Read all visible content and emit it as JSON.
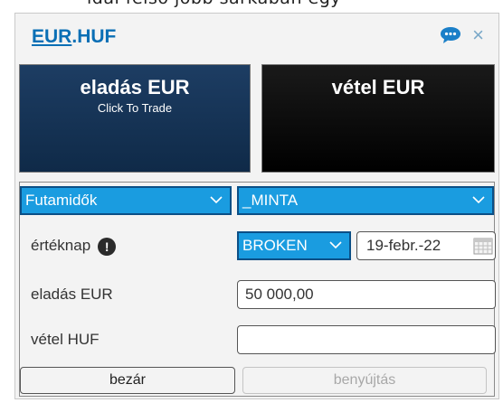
{
  "top_caption": "ldal felsó jobb sarkaban egy",
  "window": {
    "pair_base": "EUR",
    "pair_sep": ".",
    "pair_quote": "HUF",
    "icons": {
      "chat": "speech-bubble-icon",
      "close": "close-icon",
      "close_glyph": "×"
    }
  },
  "tiles": {
    "sell": {
      "title": "eladás EUR",
      "subtitle": "Click To Trade"
    },
    "buy": {
      "title": "vétel EUR"
    }
  },
  "form": {
    "tenor_select": "Futamidők",
    "account_select": "_MINTA",
    "value_date_label": "értéknap",
    "value_date_type": "BROKEN",
    "value_date": "19-febr.-22",
    "sell_label": "eladás EUR",
    "sell_amount": "50 000,00",
    "buy_label": "vétel HUF",
    "buy_amount": "",
    "close_label": "bezár",
    "submit_label": "benyújtás"
  },
  "colors": {
    "accent": "#0a6fb5",
    "select_bg": "#1a9ce0",
    "sell_tile": "#123153",
    "buy_tile": "#000000"
  }
}
